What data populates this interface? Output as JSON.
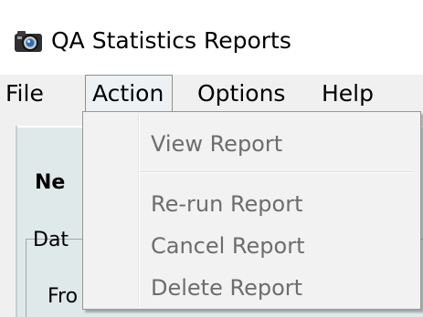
{
  "window": {
    "title": "QA Statistics Reports",
    "icon": "camera-icon"
  },
  "menubar": {
    "file": "File",
    "action": "Action",
    "options": "Options",
    "help": "Help"
  },
  "background": {
    "label_ne": "Ne",
    "label_dat": "Dat",
    "label_fro": "Fro"
  },
  "action_menu": {
    "items": [
      {
        "label": "View Report",
        "enabled": false
      },
      {
        "label": "Re-run Report",
        "enabled": false
      },
      {
        "label": "Cancel Report",
        "enabled": false
      },
      {
        "label": "Delete Report",
        "enabled": false
      }
    ]
  },
  "colors": {
    "panel": "#dfe9e9",
    "disabled_text": "#6d6d6d",
    "menu_bg": "#f2f2f2"
  }
}
